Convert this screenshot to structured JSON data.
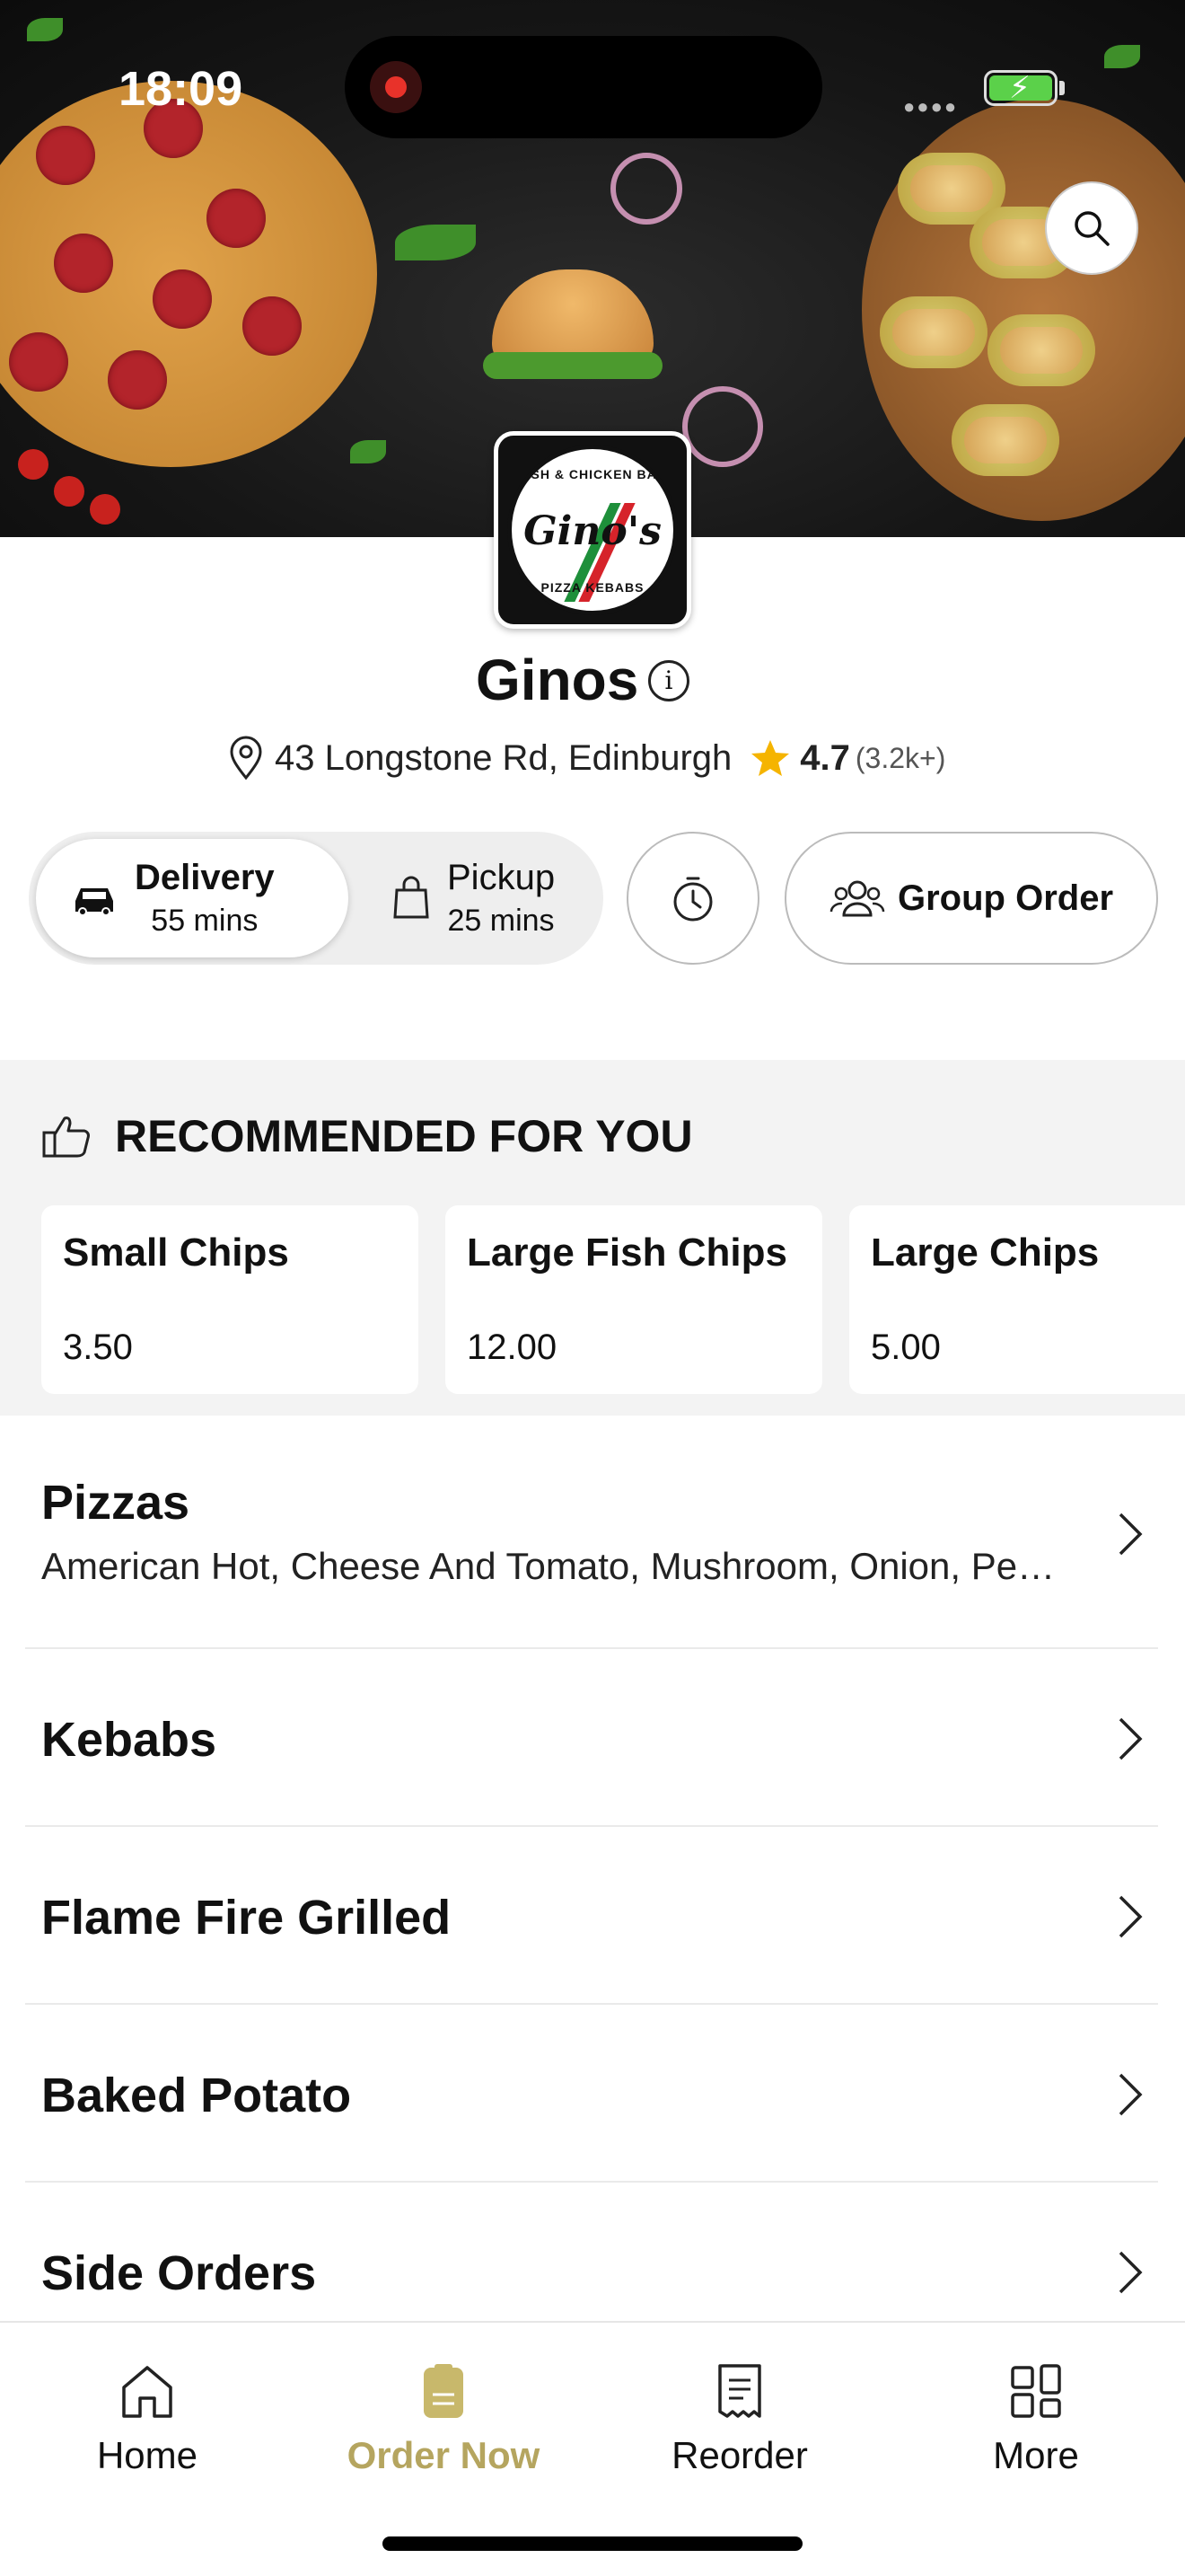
{
  "status_bar": {
    "time": "18:09"
  },
  "store": {
    "name": "Ginos",
    "address": "43 Longstone Rd, Edinburgh",
    "rating": "4.7",
    "rating_count": "(3.2k+)",
    "logo": {
      "text": "Gino's",
      "top_text": "FISH & CHICKEN BAR",
      "bottom_text": "PIZZA KEBABS"
    }
  },
  "order_modes": {
    "delivery": {
      "label": "Delivery",
      "time": "55 mins",
      "selected": true
    },
    "pickup": {
      "label": "Pickup",
      "time": "25 mins",
      "selected": false
    }
  },
  "group_order_label": "Group Order",
  "recommended": {
    "heading": "RECOMMENDED FOR YOU",
    "items": [
      {
        "name": "Small Chips",
        "price": "3.50"
      },
      {
        "name": "Large Fish Chips",
        "price": "12.00"
      },
      {
        "name": "Large Chips",
        "price": "5.00"
      }
    ]
  },
  "categories": [
    {
      "title": "Pizzas",
      "description": "American Hot, Cheese And Tomato, Mushroom, Onion, Pepperoni"
    },
    {
      "title": "Kebabs"
    },
    {
      "title": "Flame Fire Grilled"
    },
    {
      "title": "Baked Potato"
    },
    {
      "title": "Side Orders"
    }
  ],
  "tabbar": {
    "items": [
      {
        "label": "Home",
        "icon": "home-icon"
      },
      {
        "label": "Order Now",
        "icon": "order-icon",
        "active": true
      },
      {
        "label": "Reorder",
        "icon": "receipt-icon"
      },
      {
        "label": "More",
        "icon": "grid-icon"
      }
    ]
  },
  "colors": {
    "accent": "#b5a55f",
    "rating_star": "#f5b400",
    "recording": "#e8322a",
    "battery": "#5bd14a"
  }
}
